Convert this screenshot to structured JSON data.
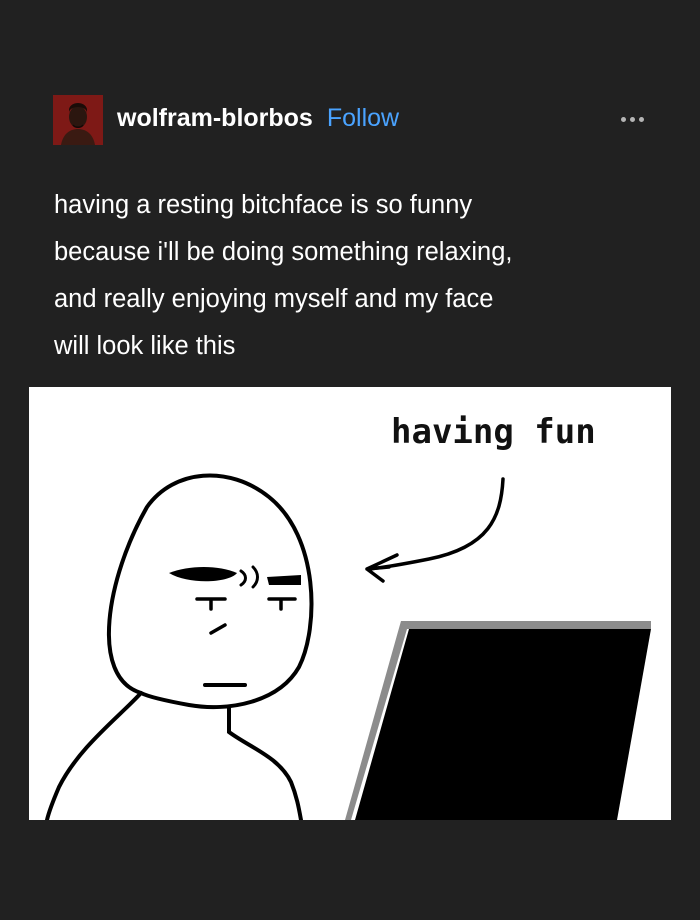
{
  "post": {
    "username": "wolfram-blorbos",
    "follow_label": "Follow",
    "text": "having a resting bitchface is so funny\nbecause i'll be doing something relaxing,\nand really enjoying myself and my face\nwill look like this",
    "image": {
      "caption": "having fun"
    }
  },
  "colors": {
    "background": "#212121",
    "follow": "#4aa3ff",
    "text": "#ffffff"
  },
  "icons": {
    "more": "more-horizontal-icon"
  }
}
